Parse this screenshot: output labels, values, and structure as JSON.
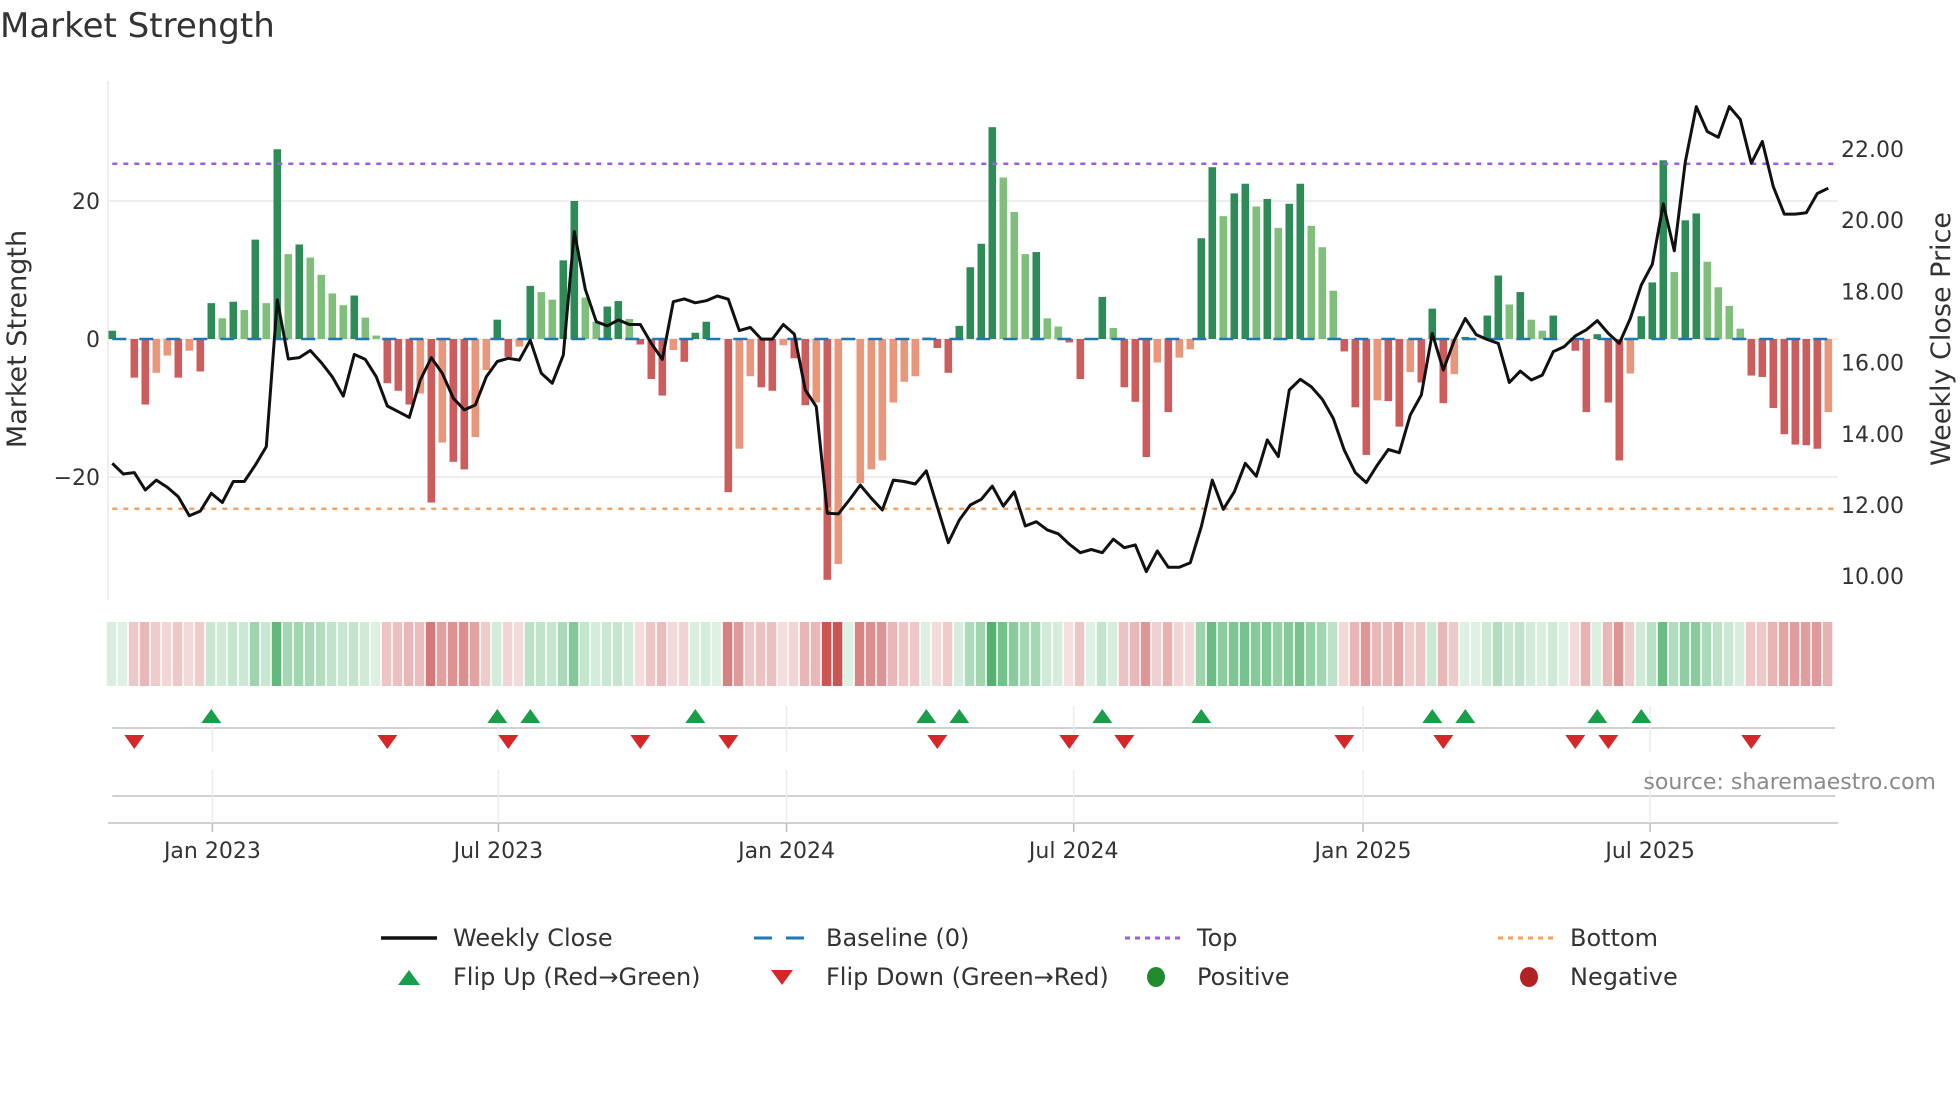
{
  "title": "Market Strength",
  "source": "source: sharemaestro.com",
  "colors": {
    "strong_up": "#2e8b57",
    "weak_up": "#7fbf7b",
    "strong_down": "#cd5c5c",
    "weak_down": "#e9967a",
    "baseline": "#1f77b4",
    "top": "#9b5de5",
    "bottom": "#f4a261",
    "price": "#111111",
    "flip_up": "#1a9e4a",
    "flip_down": "#d62728",
    "positive": "#1f8a2e",
    "negative": "#b22222"
  },
  "legend": [
    {
      "key": "weekly_close",
      "label": "Weekly Close"
    },
    {
      "key": "baseline",
      "label": "Baseline (0)"
    },
    {
      "key": "top",
      "label": "Top"
    },
    {
      "key": "bottom",
      "label": "Bottom"
    },
    {
      "key": "flip_up",
      "label": "Flip Up (Red→Green)"
    },
    {
      "key": "flip_down",
      "label": "Flip Down (Green→Red)"
    },
    {
      "key": "positive",
      "label": "Positive"
    },
    {
      "key": "negative",
      "label": "Negative"
    }
  ],
  "chart_data": {
    "type": "bar",
    "title": "Market Strength",
    "ylabel": "Market Strength",
    "y2label": "Weekly Close Price",
    "frequency": "weekly",
    "ylim": [
      -38,
      35.5
    ],
    "y2lim": [
      9.0,
      23.8
    ],
    "yticks": [
      {
        "v": 20,
        "label": "20"
      },
      {
        "v": 0,
        "label": "0"
      },
      {
        "v": -20,
        "label": "−20"
      }
    ],
    "y2ticks": [
      {
        "v": 10,
        "label": "10.00"
      },
      {
        "v": 12,
        "label": "12.00"
      },
      {
        "v": 14,
        "label": "14.00"
      },
      {
        "v": 16,
        "label": "16.00"
      },
      {
        "v": 18,
        "label": "18.00"
      },
      {
        "v": 20,
        "label": "20.00"
      },
      {
        "v": 22,
        "label": "22.00"
      }
    ],
    "xticks": [
      {
        "week": 9.1,
        "label": "Jan 2023"
      },
      {
        "week": 35.1,
        "label": "Jul 2023"
      },
      {
        "week": 61.3,
        "label": "Jan 2024"
      },
      {
        "week": 87.4,
        "label": "Jul 2024"
      },
      {
        "week": 113.7,
        "label": "Jan 2025"
      },
      {
        "week": 139.8,
        "label": "Jul 2025"
      }
    ],
    "top_level": 25.4,
    "bottom_level": -24.6,
    "baseline": 0,
    "strength": [
      1.2,
      0,
      -5.6,
      -9.5,
      -4.9,
      -2.4,
      -5.6,
      -1.7,
      -4.7,
      5.2,
      3.0,
      5.4,
      4.2,
      14.4,
      5.2,
      27.5,
      12.3,
      13.7,
      11.8,
      9.3,
      6.6,
      4.9,
      6.3,
      3.1,
      0.5,
      -6.4,
      -7.5,
      -9.5,
      -7.9,
      -23.7,
      -15.0,
      -17.8,
      -18.9,
      -14.2,
      -4.5,
      2.8,
      -2.6,
      -1.1,
      7.7,
      6.8,
      5.7,
      11.4,
      20.0,
      6.0,
      2.5,
      4.7,
      5.5,
      2.9,
      -0.8,
      -5.8,
      -8.2,
      -1.6,
      -3.3,
      0.9,
      2.5,
      0,
      -22.2,
      -15.9,
      -5.4,
      -7.0,
      -7.5,
      -0.9,
      -2.8,
      -9.6,
      -9.2,
      -34.9,
      -32.6,
      0,
      -20.9,
      -18.9,
      -17.6,
      -9.2,
      -6.2,
      -5.4,
      0.2,
      -1.3,
      -4.9,
      1.9,
      10.4,
      13.8,
      30.7,
      23.4,
      18.4,
      12.3,
      12.6,
      3.0,
      1.8,
      -0.5,
      -5.8,
      0,
      6.1,
      1.6,
      -7.0,
      -9.1,
      -17.1,
      -3.4,
      -10.6,
      -2.7,
      -1.5,
      14.6,
      24.9,
      17.8,
      21.1,
      22.5,
      19.2,
      20.3,
      16.1,
      19.6,
      22.5,
      16.4,
      13.3,
      7.0,
      -1.8,
      -9.9,
      -16.8,
      -8.9,
      -9.0,
      -12.7,
      -4.8,
      -6.3,
      4.4,
      -9.3,
      -5.1,
      0.3,
      0,
      3.4,
      9.2,
      5.0,
      6.8,
      2.8,
      1.2,
      3.4,
      0,
      -1.7,
      -10.6,
      0.7,
      -9.2,
      -17.6,
      -5.0,
      3.3,
      8.2,
      25.9,
      9.7,
      17.2,
      18.2,
      11.2,
      7.5,
      4.8,
      1.5,
      -5.3,
      -5.5,
      -10.0,
      -13.8,
      -15.3,
      -15.4,
      -15.9,
      -10.6
    ],
    "weekly_close": [
      13.17,
      12.87,
      12.91,
      12.42,
      12.7,
      12.5,
      12.23,
      11.7,
      11.83,
      12.33,
      12.07,
      12.66,
      12.66,
      13.12,
      13.64,
      17.76,
      16.1,
      16.14,
      16.34,
      16.0,
      15.6,
      15.06,
      16.23,
      16.09,
      15.6,
      14.78,
      14.62,
      14.46,
      15.51,
      16.14,
      15.7,
      15.0,
      14.67,
      14.81,
      15.6,
      16.03,
      16.12,
      16.07,
      16.63,
      15.7,
      15.42,
      16.21,
      19.68,
      18.06,
      17.15,
      17.03,
      17.2,
      17.07,
      17.07,
      16.54,
      16.09,
      17.71,
      17.79,
      17.68,
      17.74,
      17.87,
      17.78,
      16.9,
      16.99,
      16.66,
      16.66,
      17.07,
      16.8,
      15.23,
      14.76,
      11.77,
      11.75,
      12.14,
      12.56,
      12.19,
      11.86,
      12.7,
      12.66,
      12.59,
      12.96,
      11.95,
      10.94,
      11.58,
      12.0,
      12.16,
      12.53,
      11.97,
      12.37,
      11.41,
      11.53,
      11.3,
      11.19,
      10.9,
      10.66,
      10.75,
      10.66,
      11.04,
      10.8,
      10.88,
      10.13,
      10.71,
      10.25,
      10.25,
      10.38,
      11.39,
      12.7,
      11.88,
      12.37,
      13.17,
      12.81,
      13.83,
      13.36,
      15.23,
      15.53,
      15.32,
      14.97,
      14.43,
      13.54,
      12.91,
      12.63,
      13.12,
      13.56,
      13.47,
      14.53,
      15.09,
      16.82,
      15.79,
      16.63,
      17.24,
      16.78,
      16.65,
      16.54,
      15.44,
      15.76,
      15.51,
      15.65,
      16.31,
      16.45,
      16.75,
      16.92,
      17.18,
      16.82,
      16.54,
      17.24,
      18.18,
      18.76,
      20.46,
      19.14,
      21.64,
      23.19,
      22.49,
      22.33,
      23.19,
      22.83,
      21.6,
      22.21,
      20.94,
      20.17,
      20.17,
      20.21,
      20.75,
      20.9
    ],
    "flip_up_weeks": [
      9,
      35,
      38,
      53,
      74,
      77,
      90,
      99,
      120,
      123,
      135,
      139
    ],
    "flip_down_weeks": [
      2,
      25,
      36,
      48,
      56,
      75,
      87,
      92,
      112,
      121,
      133,
      136,
      149
    ]
  }
}
